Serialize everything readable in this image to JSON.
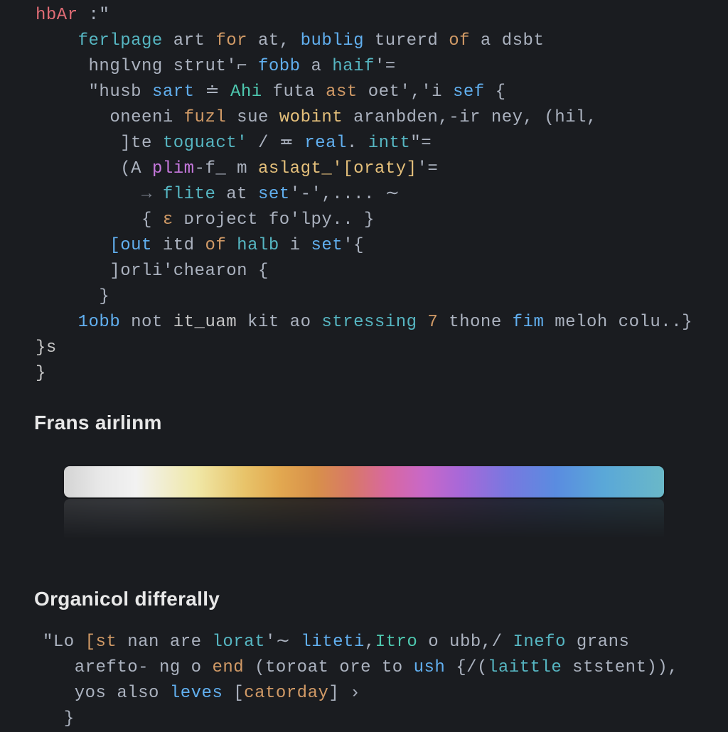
{
  "code1": {
    "l1": {
      "a": "hbAr",
      "b": " :\""
    },
    "l2": {
      "a": "ferlpage",
      "b": " art ",
      "c": "for",
      "d": " at, ",
      "e": "bublig",
      "f": " turerd ",
      "g": "of",
      "h": " a dsbt"
    },
    "l3": {
      "a": "hnglvng strut'⌐ ",
      "b": "fobb",
      "c": " a ",
      "d": "haif",
      "e": "'="
    },
    "l4": {
      "a": "\"husb ",
      "b": "sart",
      "c": " ≐ ",
      "d": "Ahi",
      "e": " futa ",
      "f": "ast",
      "g": " oet','i ",
      "h": "sef",
      "i": " {"
    },
    "l5": {
      "a": "oneeni ",
      "b": "fuzl",
      "c": " sue ",
      "d": "wobint",
      "e": " aranbden,-ir ney, (hil,"
    },
    "l6": {
      "a": "]te ",
      "b": "toguact'",
      "c": " / ≖ ",
      "d": "real",
      "e": ". ",
      "f": "intt",
      "g": "\"="
    },
    "l7": {
      "a": "(A ",
      "b": "plim",
      "c": "-f_ m ",
      "d": "aslagt_'[oraty]",
      "e": "'="
    },
    "l8": {
      "a": "→ ",
      "b": "flite",
      "c": " at ",
      "d": "set",
      "e": "'-',.... ∼"
    },
    "l9": {
      "a": "{ ",
      "b": "ɛ",
      "c": " ᴅroject fo'lpy.. }"
    },
    "l10": {
      "a": "[out ",
      "b": "itd ",
      "c": "of ",
      "d": "halb",
      "e": " i ",
      "f": "set",
      "g": "'{"
    },
    "l11": {
      "a": "]orli'chearon {"
    },
    "l12": {
      "a": "}"
    },
    "l13": {
      "a": "1obb",
      "b": " not ",
      "c": "it_uam",
      "d": " kit ao ",
      "e": "stressing",
      "f": " 7",
      "g": " thone ",
      "h": "fim",
      "i": " meloh colu..}"
    },
    "l14": {
      "a": "}s"
    },
    "l15": {
      "a": "}"
    }
  },
  "heading1": "Frans airlinm",
  "heading2": "Organicol differally",
  "code2": {
    "l1": {
      "a": "\"Lo ",
      "b": "[st ",
      "c": "nan",
      "d": " are ",
      "e": "lorat",
      "f": "'∼ ",
      "g": "liteti",
      "h": ",",
      "i": "Itro",
      "j": " o ubb,/ ",
      "k": "Inefo",
      "l": " grans"
    },
    "l2": {
      "a": "arefto- ng o ",
      "b": "end",
      "c": " (toroat ore to ",
      "d": "ush",
      "e": " {/(",
      "f": "laittle",
      "g": " ststent)),"
    },
    "l3": {
      "a": "yos also ",
      "b": "leves",
      "c": " [",
      "d": "catorday",
      "e": "] ›"
    },
    "l4": {
      "a": "}"
    }
  }
}
